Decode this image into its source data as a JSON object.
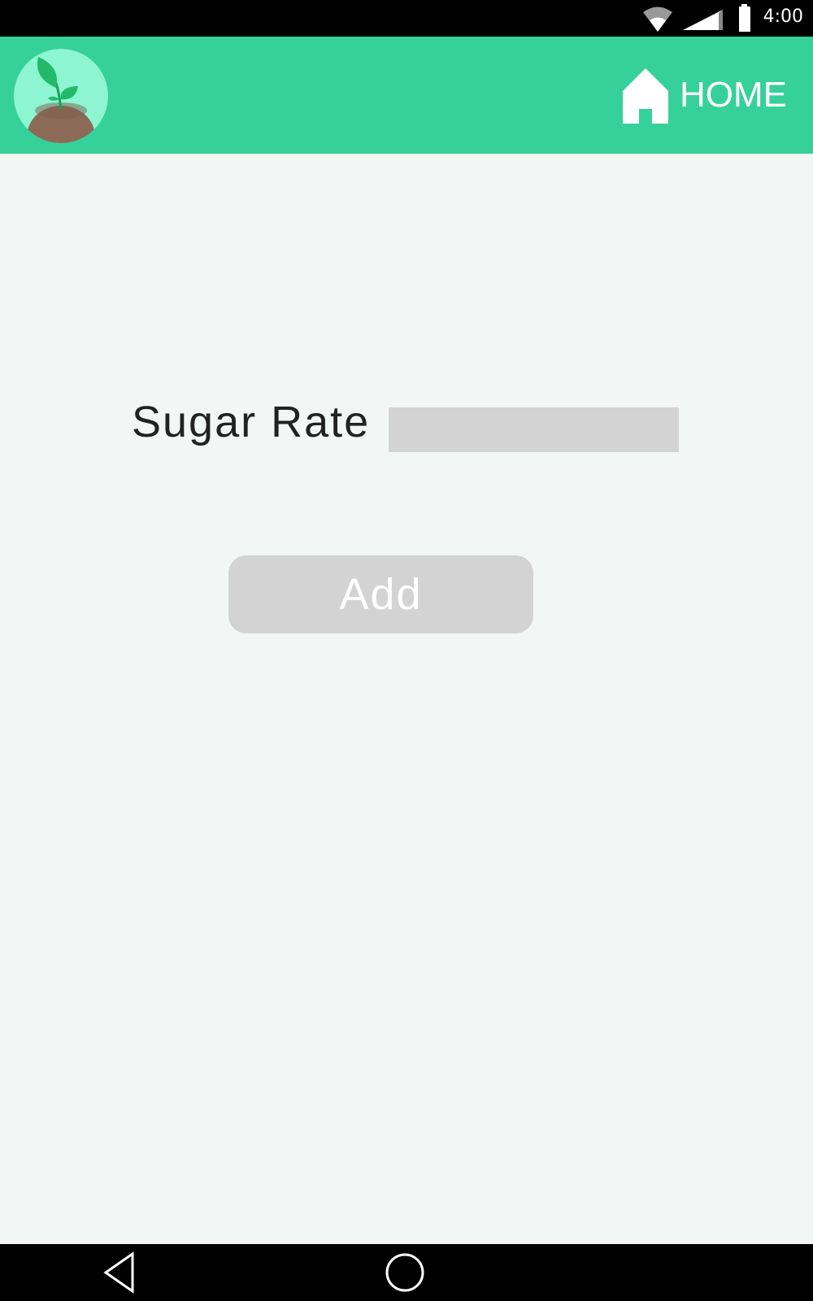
{
  "status_bar": {
    "time": "4:00",
    "icons": [
      "wifi-icon",
      "cell-signal-icon",
      "battery-icon"
    ]
  },
  "app_bar": {
    "logo": "plant-logo-icon",
    "home_label": "HOME",
    "home_icon": "home-icon"
  },
  "form": {
    "sugar_label": "Sugar Rate",
    "sugar_value": "",
    "sugar_placeholder": "",
    "add_label": "Add"
  },
  "nav_bar": {
    "icons": [
      "back-icon",
      "home-circle-icon"
    ]
  },
  "colors": {
    "app_bar": "#36d19a",
    "background": "#f2f7f5",
    "input_fill": "#d3d3d3",
    "button_fill": "#d3d3d3"
  }
}
